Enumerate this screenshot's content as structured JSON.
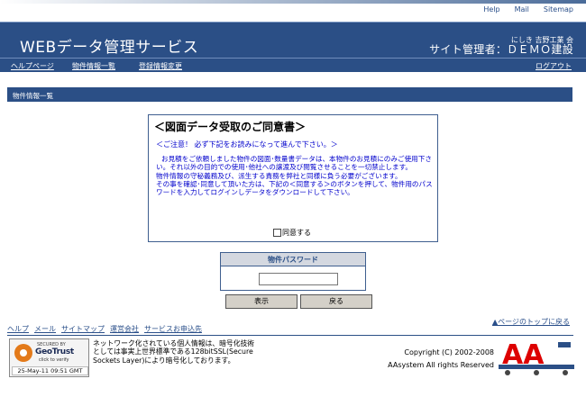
{
  "top_links": [
    "Help",
    "Mail",
    "Sitemap"
  ],
  "header": {
    "title": "WEBデータ管理サービス",
    "user_small": "にしき 吉野工業 会",
    "user_big": "サイト管理者：ＤＥＭＯ建設"
  },
  "nav": {
    "items": [
      "ヘルプページ",
      "物件情報一覧",
      "登録情報変更"
    ],
    "logout": "ログアウト"
  },
  "section_title": "物件情報一覧",
  "agreement": {
    "title": "＜図面データ受取のご同意書＞",
    "caution": "＜ご注意！ 必ず下記をお読みになって進んで下さい。＞",
    "body": [
      "お見積をご依頼しました物件の図面･数量書データは、本物件のお見積にのみご使用下さい。それ以外の目的での使用･他社への譲渡及び閲覧させることを一切禁止します。",
      "物件情報の守秘義務及び、派生する責務を弊社と同様に負う必要がございます。",
      "その事を確認･同意して頂いた方は、下記の＜同意する＞のボタンを押して、物件用のパスワードを入力してログインしデータをダウンロードして下さい。"
    ],
    "checkbox_label": "同意する"
  },
  "password": {
    "header": "物件パスワード",
    "value": ""
  },
  "buttons": {
    "display": "表示",
    "back": "戻る"
  },
  "page_top": "▲ページのトップに戻る",
  "footer_links": [
    "ヘルプ",
    "メール",
    "サイトマップ",
    "運営会社",
    "サービスお申込先"
  ],
  "seal": {
    "secured_by": "SECURED BY",
    "brand": "GeoTrust",
    "click": "click to verify",
    "date": "25-May-11 09:51 GMT"
  },
  "ssl_text": "ネットワーク化されている個人情報は、暗号化技術としては事実上世界標準である128bitSSL(Secure Sockets Layer)により暗号化しております。",
  "copyright": {
    "line1": "Copyright (C) 2002-2008",
    "line2": "AAsystem All rights Reserved"
  },
  "colors": {
    "header_blue": "#2b4f86",
    "logo_red": "#dd0000"
  }
}
